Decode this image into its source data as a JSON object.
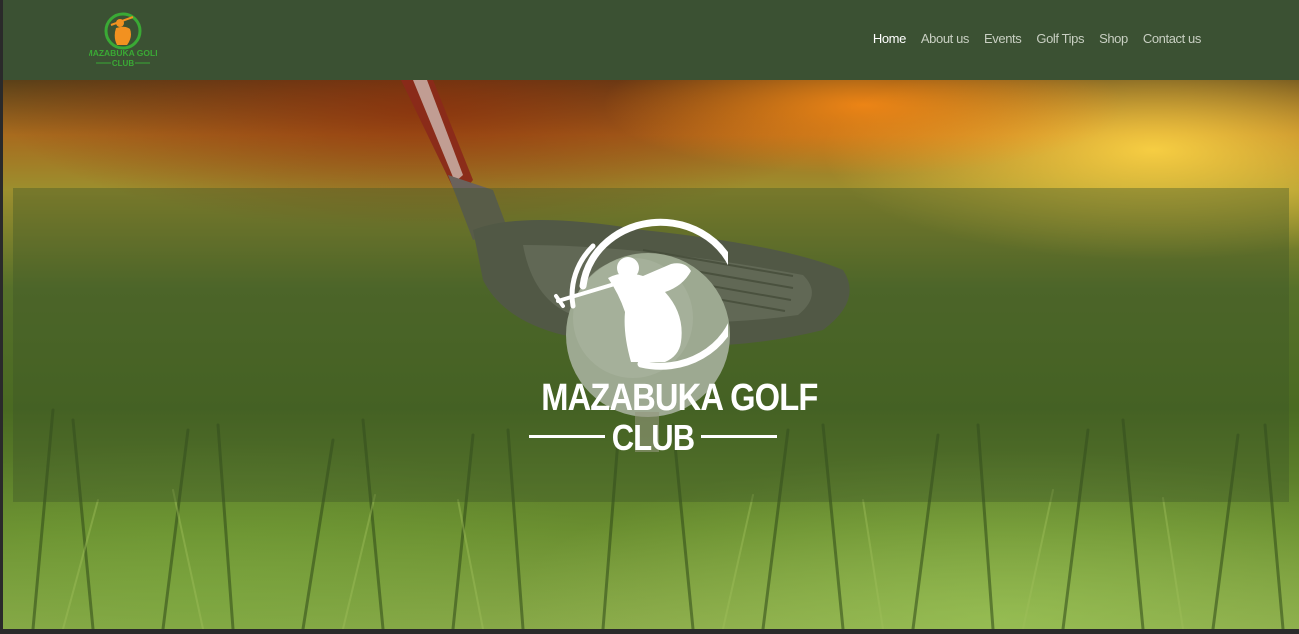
{
  "brand": {
    "name": "MAZABUKA GOLF",
    "sub": "CLUB",
    "logo_icon": "golfer-emblem-icon",
    "header_colors": {
      "bg": "#3b5133",
      "logo_green": "#3aa935",
      "logo_orange": "#f29120"
    }
  },
  "nav": {
    "items": [
      {
        "label": "Home",
        "active": true
      },
      {
        "label": "About us",
        "active": false
      },
      {
        "label": "Events",
        "active": false
      },
      {
        "label": "Golf Tips",
        "active": false
      },
      {
        "label": "Shop",
        "active": false
      },
      {
        "label": "Contact us",
        "active": false
      }
    ]
  },
  "hero": {
    "title": "MAZABUKA GOLF",
    "subtitle": "CLUB",
    "emblem_icon": "golfer-emblem-icon",
    "background_icon": "golf-club-and-ball-photo"
  }
}
